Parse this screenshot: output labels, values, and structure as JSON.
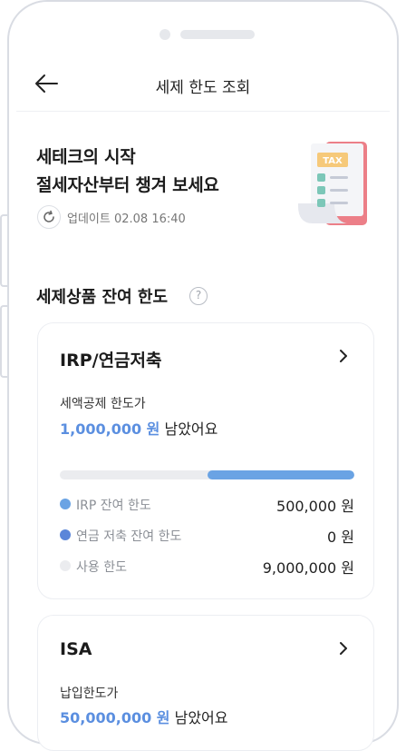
{
  "header": {
    "title": "세제 한도 조회"
  },
  "hero": {
    "line1": "세테크의 시작",
    "line2": "절세자산부터 챙겨 보세요",
    "update_text": "업데이트 02.08  16:40",
    "illustration_label": "TAX"
  },
  "section": {
    "title": "세제상품 잔여 한도",
    "help": "?"
  },
  "irp_card": {
    "title": "IRP/연금저축",
    "subtitle": "세액공제 한도가",
    "amount": "1,000,000 원",
    "amount_suffix": "남았어요",
    "usage_fraction": 0.5,
    "legend": [
      {
        "label": "IRP 잔여 한도",
        "value": "500,000 원",
        "color": "#6aa3e4"
      },
      {
        "label": "연금 저축 잔여 한도",
        "value": "0 원",
        "color": "#5b86d9"
      },
      {
        "label": "사용 한도",
        "value": "9,000,000 원",
        "color": "#ebecef"
      }
    ]
  },
  "isa_card": {
    "title": "ISA",
    "subtitle": "납입한도가",
    "amount": "50,000,000 원",
    "amount_suffix": "남았어요"
  },
  "colors": {
    "accent": "#5b8fe0",
    "bar": "#6aa3e4",
    "track": "#ebecef"
  }
}
